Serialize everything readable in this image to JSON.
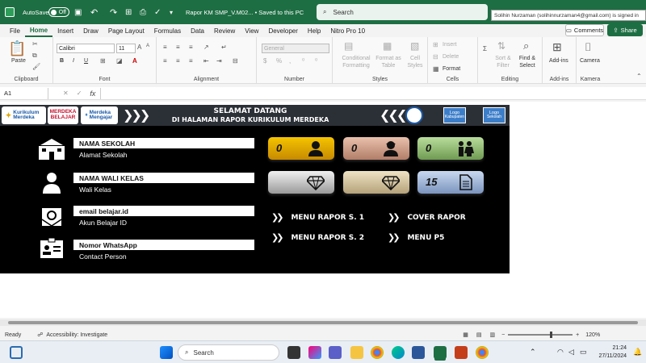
{
  "titlebar": {
    "autosave_label": "AutoSave",
    "autosave_state": "Off",
    "doc_title": "Rapor KM SMP_V.M02... • Saved to this PC",
    "search_placeholder": "Search",
    "signin_tooltip": "Solihin Nurzaman (solihinnurzaman4@gmail.com) is signed in"
  },
  "menu": {
    "tabs": [
      "File",
      "Home",
      "Insert",
      "Draw",
      "Page Layout",
      "Formulas",
      "Data",
      "Review",
      "View",
      "Developer",
      "Help",
      "Nitro Pro 10"
    ],
    "active": "Home",
    "comments_label": "Comments",
    "share_label": "Share"
  },
  "ribbon": {
    "clipboard": {
      "label": "Clipboard",
      "paste": "Paste"
    },
    "font": {
      "label": "Font",
      "family": "Calibri",
      "size": "11",
      "bold": "B",
      "italic": "I",
      "underline": "U"
    },
    "alignment": {
      "label": "Alignment"
    },
    "number": {
      "label": "Number",
      "format": "General"
    },
    "styles": {
      "label": "Styles",
      "conditional": "Conditional Formatting",
      "format_table": "Format as Table",
      "cell_styles": "Cell Styles"
    },
    "cells": {
      "label": "Cells",
      "insert": "Insert",
      "delete": "Delete",
      "format": "Format"
    },
    "editing": {
      "label": "Editing",
      "sort": "Sort & Filter",
      "find": "Find & Select"
    },
    "addins": {
      "label": "Add-ins",
      "button": "Add-ins"
    },
    "kamera": {
      "label": "Kamera",
      "button": "Camera"
    }
  },
  "formula_bar": {
    "cell_ref": "A1",
    "fx": "fx",
    "formula": ""
  },
  "dashboard": {
    "logos": {
      "kurikulum_merdeka": "Kurikulum Merdeka",
      "merdeka_belajar": "MERDEKA BELAJAR",
      "merdeka_mengajar": "Merdeka Mengajar",
      "kabupaten": "Kabupaten",
      "sekolah": "Sekolah",
      "logo_word": "Logo"
    },
    "welcome_line1": "SELAMAT DATANG",
    "welcome_line2": "DI HALAMAN RAPOR KURIKULUM MERDEKA",
    "fields": [
      {
        "label": "NAMA SEKOLAH",
        "value": "Alamat Sekolah",
        "icon": "school-icon"
      },
      {
        "label": "NAMA WALI KELAS",
        "value": "Wali Kelas",
        "icon": "user-icon"
      },
      {
        "label": "email belajar.id",
        "value": "Akun Belajar ID",
        "icon": "email-icon"
      },
      {
        "label": "Nomor WhatsApp",
        "value": "Contact Person",
        "icon": "id-card-icon"
      }
    ],
    "stats": [
      {
        "value": "0",
        "icon": "male-student-icon",
        "color": "#e6a600"
      },
      {
        "value": "0",
        "icon": "female-student-icon",
        "color": "#c99a86"
      },
      {
        "value": "0",
        "icon": "students-icon",
        "color": "#9ac47e"
      },
      {
        "value": "",
        "icon": "diamond-icon",
        "color": "#c8c8c8"
      },
      {
        "value": "",
        "icon": "diamond-icon",
        "color": "#d8c9a6"
      },
      {
        "value": "15",
        "icon": "document-icon",
        "color": "#9fb6d8"
      }
    ],
    "menu_links": {
      "rapor_s1": "MENU RAPOR S. 1",
      "rapor_s2": "MENU RAPOR S. 2",
      "cover": "COVER RAPOR",
      "p5": "MENU P5"
    }
  },
  "status": {
    "ready": "Ready",
    "accessibility": "Accessibility: Investigate",
    "zoom": "120%"
  },
  "taskbar": {
    "search": "Search",
    "time": "21:24",
    "date": "27/11/2024"
  }
}
